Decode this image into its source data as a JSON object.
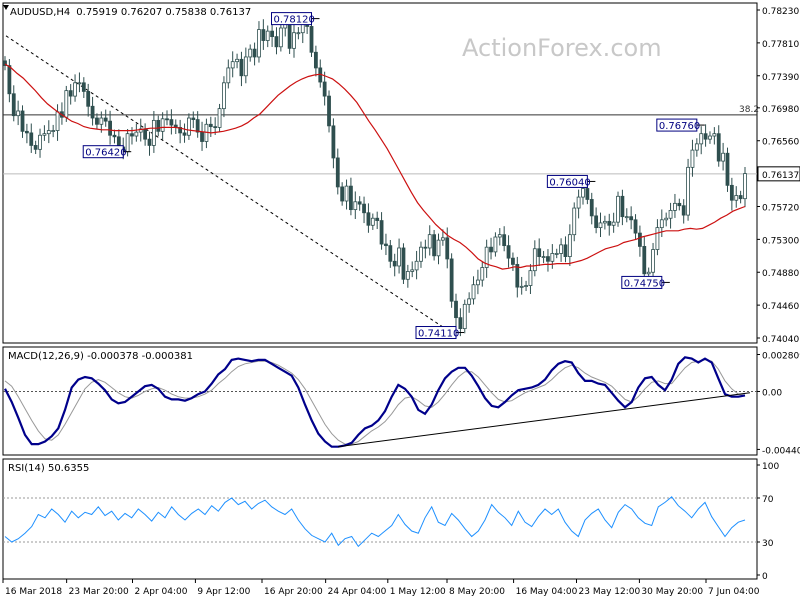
{
  "header": {
    "symbol_info": "AUDUSD,H4",
    "ohlc": "0.75919 0.76207 0.75838 0.76137"
  },
  "watermark": "ActionForex.com",
  "colors": {
    "candle": "#2f4f4f",
    "ma": "#cc1111",
    "macd": "#00008b",
    "signal": "#999999",
    "rsi": "#1e90ff",
    "grid": "#999999",
    "label_bg": "#ffffff",
    "label_border": "#000080"
  },
  "chart_data": [
    {
      "type": "candlestick",
      "name": "price",
      "ylim": [
        0.7404,
        0.7823
      ],
      "yticks": [
        "0.78230",
        "0.77810",
        "0.77390",
        "0.76980",
        "0.76560",
        "0.76137",
        "0.75720",
        "0.75300",
        "0.74880",
        "0.74460",
        "0.74040"
      ],
      "current_price": "0.76137",
      "fib_level": {
        "label": "38.2",
        "value": 0.7689
      },
      "annotations": [
        {
          "text": "0.78120",
          "value": 0.7812
        },
        {
          "text": "0.76420",
          "value": 0.7642
        },
        {
          "text": "0.76760",
          "value": 0.7676
        },
        {
          "text": "0.76040",
          "value": 0.7604
        },
        {
          "text": "0.74750",
          "value": 0.7475
        },
        {
          "text": "0.74110",
          "value": 0.7411
        }
      ],
      "close": [
        0.7752,
        0.7716,
        0.7688,
        0.7694,
        0.7668,
        0.7666,
        0.765,
        0.7645,
        0.7663,
        0.7665,
        0.7669,
        0.7669,
        0.7693,
        0.7686,
        0.772,
        0.7713,
        0.773,
        0.773,
        0.7719,
        0.77,
        0.7685,
        0.7677,
        0.7685,
        0.7681,
        0.7663,
        0.7661,
        0.7648,
        0.7642,
        0.7665,
        0.7662,
        0.7667,
        0.7671,
        0.7658,
        0.765,
        0.7682,
        0.7668,
        0.7684,
        0.7683,
        0.7676,
        0.7673,
        0.7666,
        0.7663,
        0.7685,
        0.7683,
        0.7667,
        0.7655,
        0.7677,
        0.7674,
        0.7673,
        0.7697,
        0.773,
        0.7749,
        0.7757,
        0.776,
        0.7739,
        0.7763,
        0.7773,
        0.7763,
        0.7798,
        0.7784,
        0.7796,
        0.7789,
        0.7776,
        0.78,
        0.7806,
        0.7774,
        0.7794,
        0.7794,
        0.7806,
        0.7802,
        0.7769,
        0.7749,
        0.7731,
        0.7713,
        0.7675,
        0.7634,
        0.7597,
        0.7579,
        0.7598,
        0.7568,
        0.7578,
        0.7575,
        0.7564,
        0.7548,
        0.7557,
        0.7554,
        0.7524,
        0.7522,
        0.7502,
        0.7496,
        0.7519,
        0.7479,
        0.7489,
        0.7491,
        0.7502,
        0.752,
        0.7519,
        0.7536,
        0.7509,
        0.7529,
        0.7532,
        0.7505,
        0.7451,
        0.743,
        0.7416,
        0.7447,
        0.7454,
        0.7472,
        0.7478,
        0.7494,
        0.752,
        0.7514,
        0.7533,
        0.7536,
        0.7522,
        0.7506,
        0.7498,
        0.7469,
        0.747,
        0.7471,
        0.749,
        0.7518,
        0.7508,
        0.7508,
        0.7502,
        0.7512,
        0.7512,
        0.7523,
        0.7508,
        0.7536,
        0.757,
        0.7584,
        0.7595,
        0.7581,
        0.756,
        0.7545,
        0.7551,
        0.7553,
        0.7548,
        0.7552,
        0.7585,
        0.7559,
        0.7559,
        0.7555,
        0.7538,
        0.7521,
        0.7486,
        0.7488,
        0.7517,
        0.7545,
        0.7555,
        0.7557,
        0.7567,
        0.7576,
        0.7573,
        0.7561,
        0.7622,
        0.7644,
        0.7652,
        0.7665,
        0.7658,
        0.7662,
        0.7665,
        0.763,
        0.764,
        0.7599,
        0.758,
        0.7586,
        0.7582,
        0.7614
      ],
      "sma": [
        0.7754,
        0.7749,
        0.7742,
        0.7736,
        0.7728,
        0.772,
        0.7711,
        0.7703,
        0.7697,
        0.7691,
        0.7686,
        0.7681,
        0.7678,
        0.7674,
        0.7672,
        0.7671,
        0.767,
        0.767,
        0.7669,
        0.7669,
        0.7669,
        0.7669,
        0.767,
        0.7671,
        0.7672,
        0.7672,
        0.7673,
        0.7673,
        0.7673,
        0.7672,
        0.767,
        0.7669,
        0.7668,
        0.7667,
        0.7666,
        0.7667,
        0.7668,
        0.767,
        0.7672,
        0.7675,
        0.7679,
        0.7685,
        0.769,
        0.7698,
        0.7706,
        0.7714,
        0.772,
        0.7726,
        0.7731,
        0.7735,
        0.7738,
        0.774,
        0.7741,
        0.7738,
        0.7735,
        0.7729,
        0.7722,
        0.7714,
        0.7705,
        0.7693,
        0.7681,
        0.767,
        0.7658,
        0.7646,
        0.7632,
        0.7618,
        0.7604,
        0.759,
        0.7577,
        0.7567,
        0.7558,
        0.7549,
        0.7542,
        0.7535,
        0.753,
        0.7526,
        0.752,
        0.7513,
        0.7505,
        0.75,
        0.7497,
        0.7495,
        0.7492,
        0.7493,
        0.7495,
        0.7494,
        0.7496,
        0.7496,
        0.7497,
        0.7498,
        0.7498,
        0.7499,
        0.7499,
        0.7499,
        0.7501,
        0.7503,
        0.7506,
        0.751,
        0.7514,
        0.7518,
        0.752,
        0.7522,
        0.7526,
        0.7528,
        0.753,
        0.7533,
        0.7535,
        0.7537,
        0.7539,
        0.7541,
        0.7541,
        0.7541,
        0.7543,
        0.7544,
        0.7543,
        0.7544,
        0.7548,
        0.7552,
        0.7557,
        0.7561,
        0.7566,
        0.7569,
        0.7572
      ],
      "x_labels": [
        {
          "text": "16 Mar 2018",
          "pos": 0.0
        },
        {
          "text": "23 Mar 20:00",
          "pos": 0.086
        },
        {
          "text": "2 Apr 04:00",
          "pos": 0.175
        },
        {
          "text": "9 Apr 12:00",
          "pos": 0.26
        },
        {
          "text": "16 Apr 20:00",
          "pos": 0.35
        },
        {
          "text": "24 Apr 04:00",
          "pos": 0.436
        },
        {
          "text": "1 May 12:00",
          "pos": 0.52
        },
        {
          "text": "8 May 20:00",
          "pos": 0.6
        },
        {
          "text": "16 May 04:00",
          "pos": 0.69
        },
        {
          "text": "23 May 12:00",
          "pos": 0.775
        },
        {
          "text": "30 May 20:00",
          "pos": 0.86
        },
        {
          "text": "7 Jun 04:00",
          "pos": 0.95
        }
      ]
    },
    {
      "type": "line",
      "name": "MACD(12,26,9)",
      "title": "MACD(12,26,9) -0.000378 -0.000381",
      "ylim": [
        -0.0046,
        0.003
      ],
      "yticks": [
        "0.002809",
        "0.00",
        "-0.004403"
      ],
      "macd": [
        0.0002,
        -0.0008,
        -0.002,
        -0.0033,
        -0.004,
        -0.004,
        -0.0038,
        -0.0034,
        -0.0028,
        -0.0014,
        0.0003,
        0.0009,
        0.0011,
        0.001,
        0.0006,
        0.0001,
        -0.0006,
        -0.0009,
        -0.0008,
        -0.0004,
        0.0,
        0.0004,
        0.0005,
        0.0002,
        -0.0004,
        -0.0006,
        -0.0006,
        -0.0007,
        -0.0005,
        -0.0002,
        0.0,
        0.0006,
        0.0013,
        0.0017,
        0.0024,
        0.0025,
        0.0024,
        0.0023,
        0.0024,
        0.0024,
        0.0021,
        0.0018,
        0.0015,
        0.0012,
        0.0003,
        -0.001,
        -0.0022,
        -0.0032,
        -0.0038,
        -0.0042,
        -0.0042,
        -0.0041,
        -0.0039,
        -0.0033,
        -0.0028,
        -0.0026,
        -0.0022,
        -0.0015,
        -0.0004,
        0.0005,
        0.0002,
        -0.0004,
        -0.0014,
        -0.0017,
        -0.001,
        0.0001,
        0.001,
        0.0015,
        0.0018,
        0.0018,
        0.0012,
        0.0004,
        -0.0005,
        -0.0011,
        -0.0012,
        -0.0008,
        -0.0003,
        0.0001,
        0.0002,
        0.0003,
        0.0005,
        0.0009,
        0.0016,
        0.0021,
        0.0023,
        0.0022,
        0.0014,
        0.0008,
        0.0008,
        0.0006,
        0.0005,
        -0.0001,
        -0.0007,
        -0.0012,
        -0.0008,
        0.0003,
        0.001,
        0.0011,
        0.0005,
        0.0001,
        0.0009,
        0.0021,
        0.0026,
        0.0025,
        0.0022,
        0.0025,
        0.0022,
        0.001,
        -0.0002,
        -0.0004,
        -0.0004,
        -0.0003
      ],
      "signal": [
        0.0008,
        0.0004,
        -0.0004,
        -0.0013,
        -0.0022,
        -0.003,
        -0.0036,
        -0.0037,
        -0.0033,
        -0.0025,
        -0.0016,
        -0.0007,
        0.0002,
        0.0007,
        0.0009,
        0.0007,
        0.0003,
        -0.0001,
        -0.0004,
        -0.0005,
        -0.0003,
        0.0,
        0.0002,
        0.0003,
        0.0001,
        -0.0002,
        -0.0004,
        -0.0005,
        -0.0005,
        -0.0004,
        -0.0002,
        0.0001,
        0.0006,
        0.001,
        0.0015,
        0.0019,
        0.0021,
        0.0022,
        0.0023,
        0.0023,
        0.0022,
        0.002,
        0.0017,
        0.0014,
        0.0009,
        0.0002,
        -0.0007,
        -0.0016,
        -0.0025,
        -0.0032,
        -0.0037,
        -0.004,
        -0.004,
        -0.0038,
        -0.0034,
        -0.003,
        -0.0027,
        -0.0023,
        -0.0017,
        -0.001,
        -0.0005,
        -0.0004,
        -0.0007,
        -0.0011,
        -0.0012,
        -0.0008,
        -0.0002,
        0.0005,
        0.0011,
        0.0015,
        0.0015,
        0.0011,
        0.0005,
        -0.0001,
        -0.0006,
        -0.0008,
        -0.0007,
        -0.0004,
        -0.0001,
        0.0001,
        0.0003,
        0.0005,
        0.0009,
        0.0014,
        0.0018,
        0.002,
        0.0018,
        0.0014,
        0.0011,
        0.0009,
        0.0007,
        0.0004,
        -0.0001,
        -0.0006,
        -0.0008,
        -0.0004,
        0.0002,
        0.0007,
        0.0008,
        0.0006,
        0.0006,
        0.0012,
        0.0018,
        0.0022,
        0.0023,
        0.0024,
        0.0023,
        0.0017,
        0.0008,
        0.0002,
        -0.0002,
        -0.0003
      ]
    },
    {
      "type": "line",
      "name": "RSI(14)",
      "title": "RSI(14) 50.6355",
      "ylim": [
        0,
        100
      ],
      "yticks": [
        "100",
        "70",
        "30",
        "0"
      ],
      "levels": [
        70,
        30
      ],
      "rsi": [
        35,
        30,
        33,
        38,
        44,
        55,
        52,
        60,
        55,
        48,
        58,
        52,
        57,
        55,
        62,
        54,
        58,
        50,
        56,
        52,
        60,
        55,
        49,
        57,
        52,
        62,
        55,
        50,
        56,
        60,
        55,
        63,
        58,
        66,
        70,
        64,
        67,
        60,
        65,
        68,
        62,
        58,
        55,
        60,
        50,
        42,
        36,
        33,
        30,
        38,
        27,
        33,
        35,
        26,
        32,
        38,
        35,
        40,
        45,
        55,
        46,
        40,
        38,
        52,
        62,
        48,
        45,
        56,
        50,
        42,
        35,
        40,
        50,
        64,
        57,
        52,
        45,
        58,
        48,
        44,
        53,
        60,
        55,
        60,
        48,
        40,
        35,
        50,
        56,
        60,
        50,
        43,
        57,
        64,
        60,
        52,
        47,
        45,
        62,
        66,
        71,
        63,
        58,
        52,
        60,
        66,
        53,
        44,
        35,
        43,
        48,
        50
      ]
    }
  ]
}
